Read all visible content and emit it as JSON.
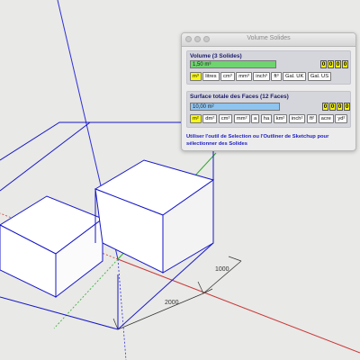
{
  "viewport": {
    "axis_colors": {
      "blue": "#2f2fd8",
      "red": "#c83a3a",
      "green": "#2faa2f"
    },
    "edge_color": "#1717c8",
    "dimensions": {
      "first": "2000",
      "second": "1000"
    }
  },
  "window": {
    "title": "Volume Solides",
    "volume": {
      "label": "Volume (3 Solides)",
      "value": "1,50 m³",
      "digits": [
        "0",
        "0",
        "0",
        "0"
      ],
      "units": [
        {
          "label": "m³",
          "selected": true
        },
        {
          "label": "litres",
          "selected": false
        },
        {
          "label": "cm³",
          "selected": false
        },
        {
          "label": "mm³",
          "selected": false
        },
        {
          "label": "inch³",
          "selected": false
        },
        {
          "label": "ft³",
          "selected": false
        },
        {
          "label": "Gal. UK",
          "selected": false
        },
        {
          "label": "Gal. US",
          "selected": false
        }
      ]
    },
    "surface": {
      "label": "Surface totale des Faces (12 Faces)",
      "value": "10,00 m²",
      "digits": [
        "0",
        "0",
        "0",
        "0"
      ],
      "units": [
        {
          "label": "m²",
          "selected": true
        },
        {
          "label": "dm²",
          "selected": false
        },
        {
          "label": "cm²",
          "selected": false
        },
        {
          "label": "mm²",
          "selected": false
        },
        {
          "label": "a",
          "selected": false
        },
        {
          "label": "ha",
          "selected": false
        },
        {
          "label": "km²",
          "selected": false
        },
        {
          "label": "inch²",
          "selected": false
        },
        {
          "label": "ft²",
          "selected": false
        },
        {
          "label": "acre",
          "selected": false
        },
        {
          "label": "yd²",
          "selected": false
        }
      ]
    },
    "hint": "Utiliser l'outil de Selection ou l'Outliner de Sketchup pour sélectionner des Solides"
  }
}
